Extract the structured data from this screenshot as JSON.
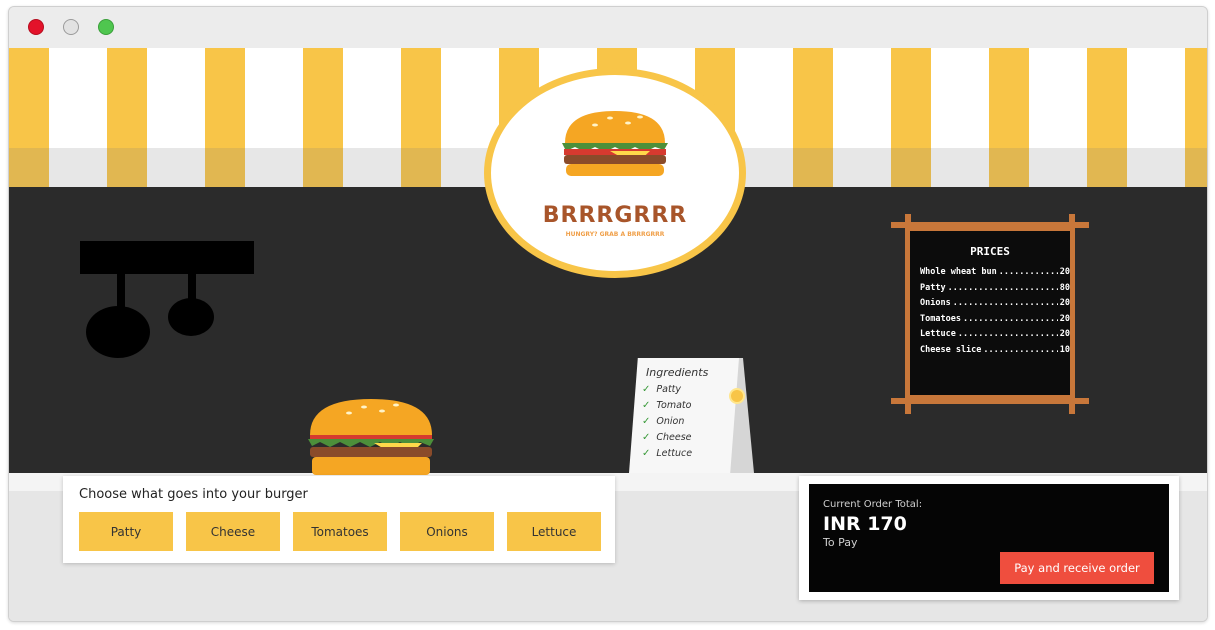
{
  "brand": {
    "name": "BRRRGRRR",
    "tagline": "HUNGRY? GRAB A BRRRGRRR"
  },
  "colors": {
    "accent_yellow": "#f8c548",
    "wall": "#2b2b2b",
    "pay_button": "#ef4e3e",
    "brand_brown": "#a8552a"
  },
  "price_board": {
    "title": "PRICES",
    "items": [
      {
        "name": "Whole wheat bun",
        "price": "20"
      },
      {
        "name": "Patty",
        "price": "80"
      },
      {
        "name": "Onions",
        "price": "20"
      },
      {
        "name": "Tomatoes",
        "price": "20"
      },
      {
        "name": "Lettuce",
        "price": "20"
      },
      {
        "name": "Cheese slice",
        "price": "10"
      }
    ]
  },
  "ingredients_card": {
    "title": "Ingredients",
    "items": [
      "Patty",
      "Tomato",
      "Onion",
      "Cheese",
      "Lettuce"
    ]
  },
  "chooser": {
    "label": "Choose what goes into your burger",
    "buttons": [
      "Patty",
      "Cheese",
      "Tomatoes",
      "Onions",
      "Lettuce"
    ]
  },
  "order": {
    "label": "Current Order Total:",
    "total": "INR 170",
    "sub": "To Pay",
    "pay_button": "Pay and receive order"
  },
  "icons": {
    "close": "window-close-dot",
    "minimize": "window-minimize-dot",
    "maximize": "window-maximize-dot"
  }
}
